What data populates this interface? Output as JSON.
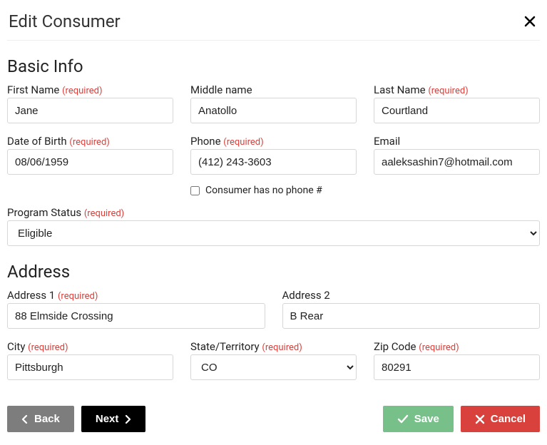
{
  "dialog": {
    "title": "Edit Consumer",
    "required_label": "(required)"
  },
  "basic": {
    "heading": "Basic Info",
    "first_name": {
      "label": "First Name",
      "value": "Jane",
      "required": true
    },
    "middle_name": {
      "label": "Middle name",
      "value": "Anatollo",
      "required": false
    },
    "last_name": {
      "label": "Last Name",
      "value": "Courtland",
      "required": true
    },
    "dob": {
      "label": "Date of Birth",
      "value": "08/06/1959",
      "required": true
    },
    "phone": {
      "label": "Phone",
      "value": "(412) 243-3603",
      "required": true
    },
    "email": {
      "label": "Email",
      "value": "aaleksashin7@hotmail.com",
      "required": false
    },
    "no_phone": {
      "label": "Consumer has no phone #",
      "checked": false
    },
    "program_status": {
      "label": "Program Status",
      "value": "Eligible",
      "required": true
    }
  },
  "address": {
    "heading": "Address",
    "address1": {
      "label": "Address 1",
      "value": "88 Elmside Crossing",
      "required": true
    },
    "address2": {
      "label": "Address 2",
      "value": "B Rear",
      "required": false
    },
    "city": {
      "label": "City",
      "value": "Pittsburgh",
      "required": true
    },
    "state": {
      "label": "State/Territory",
      "value": "CO",
      "required": true
    },
    "zip": {
      "label": "Zip Code",
      "value": "80291",
      "required": true
    }
  },
  "footer": {
    "back": "Back",
    "next": "Next",
    "save": "Save",
    "cancel": "Cancel"
  }
}
